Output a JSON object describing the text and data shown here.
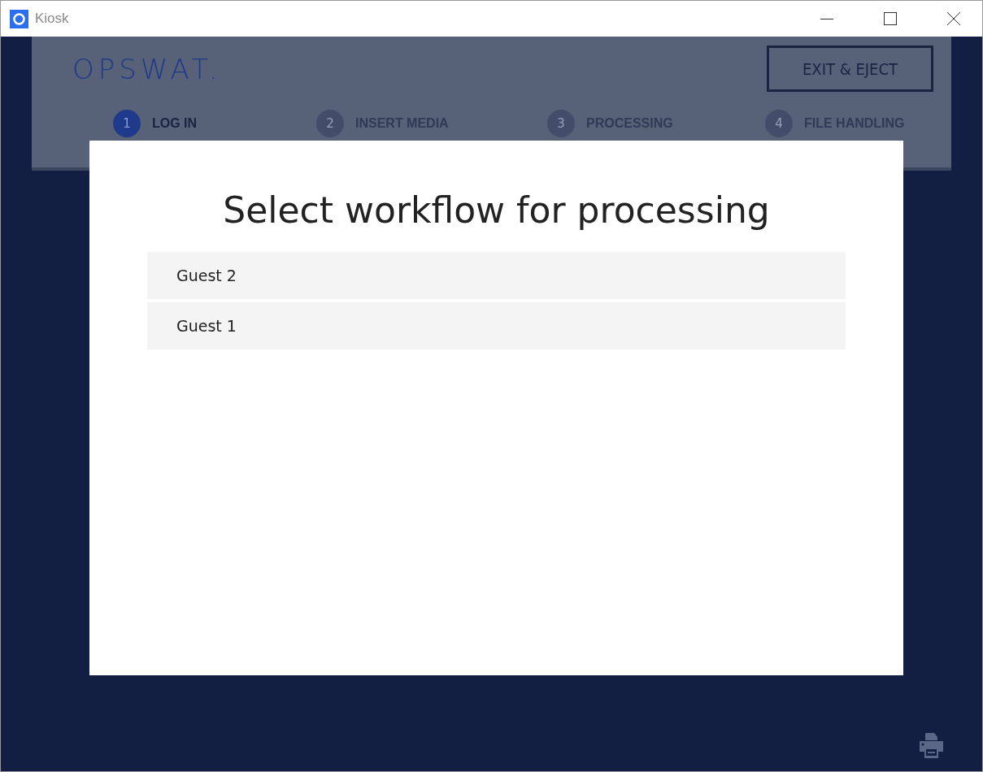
{
  "window": {
    "title": "Kiosk"
  },
  "header": {
    "logo": "OPSWAT.",
    "exit_button": "EXIT & EJECT"
  },
  "steps": [
    {
      "number": "1",
      "label": "LOG IN",
      "selected": true
    },
    {
      "number": "2",
      "label": "INSERT MEDIA",
      "selected": false
    },
    {
      "number": "3",
      "label": "PROCESSING",
      "selected": false
    },
    {
      "number": "4",
      "label": "FILE HANDLING",
      "selected": false
    }
  ],
  "dialog": {
    "title": "Select workflow for processing",
    "workflows": [
      {
        "label": "Guest 2"
      },
      {
        "label": "Guest 1"
      }
    ]
  }
}
